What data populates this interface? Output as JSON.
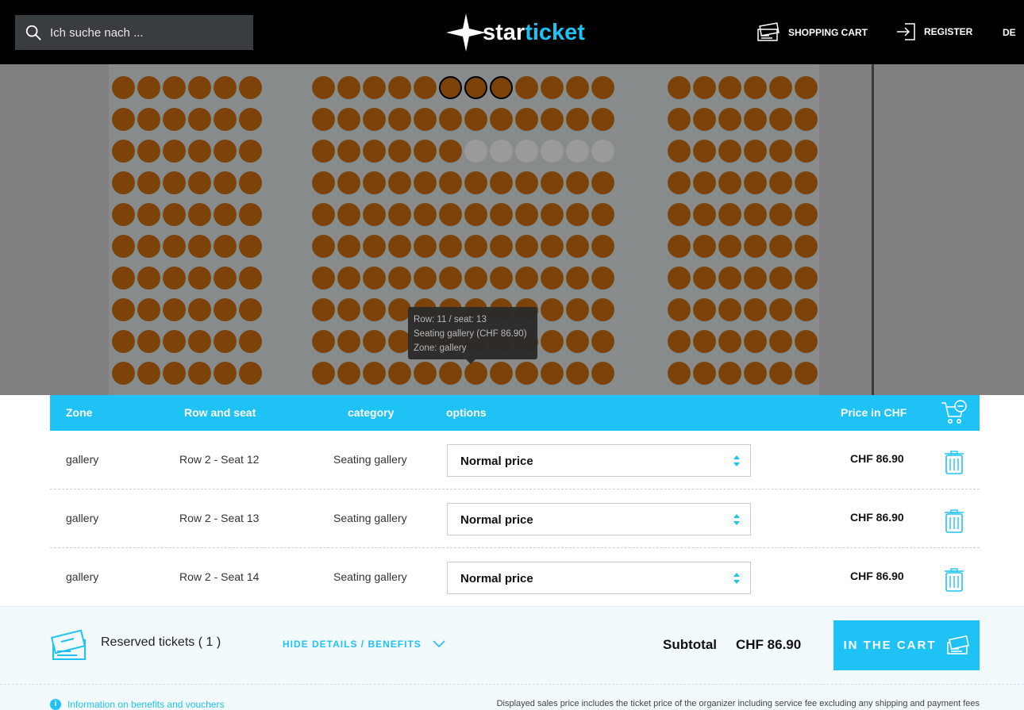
{
  "header": {
    "search_placeholder": "Ich suche nach ...",
    "logo_part1": "star",
    "logo_part2": "ticket",
    "cart_label": "SHOPPING CART",
    "register_label": "REGISTER",
    "lang": "DE"
  },
  "seatmap": {
    "tooltip": {
      "line1": "Row: 11 / seat: 13",
      "line2": "Seating gallery (CHF 86.90)",
      "line3": "Zone: gallery"
    }
  },
  "table": {
    "headers": {
      "zone": "Zone",
      "row_seat": "Row and seat",
      "category": "category",
      "options": "options",
      "price": "Price in CHF"
    },
    "rows": [
      {
        "zone": "gallery",
        "seat": "Row 2 - Seat 12",
        "category": "Seating gallery",
        "option": "Normal price",
        "price": "CHF 86.90"
      },
      {
        "zone": "gallery",
        "seat": "Row 2 - Seat 13",
        "category": "Seating gallery",
        "option": "Normal price",
        "price": "CHF 86.90"
      },
      {
        "zone": "gallery",
        "seat": "Row 2 - Seat 14",
        "category": "Seating gallery",
        "option": "Normal price",
        "price": "CHF 86.90"
      }
    ]
  },
  "summary": {
    "reserved": "Reserved tickets ( 1 )",
    "hide_details": "HIDE DETAILS / BENEFITS",
    "subtotal_label": "Subtotal",
    "subtotal_value": "CHF 86.90",
    "cart_button": "IN THE CART",
    "info_link": "Information on benefits and vouchers",
    "disclaimer": "Displayed sales price includes the ticket price of the organizer including service fee excluding any shipping and payment fees"
  },
  "colors": {
    "accent": "#1fc2f5",
    "seat": "#7c420a",
    "seat_unavailable": "#9a9a9a",
    "header_bg": "#000000"
  }
}
